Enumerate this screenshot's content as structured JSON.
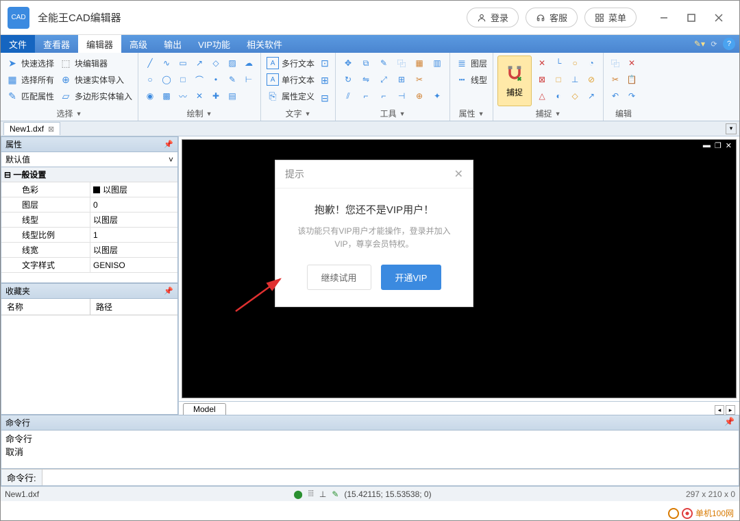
{
  "app": {
    "icon_text": "CAD",
    "title": "全能王CAD编辑器"
  },
  "header_buttons": {
    "login": "登录",
    "support": "客服",
    "menu": "菜单"
  },
  "menubar": {
    "items": [
      "文件",
      "查看器",
      "编辑器",
      "高级",
      "输出",
      "VIP功能",
      "相关软件"
    ],
    "active_file_index": 0,
    "active_tab_index": 2
  },
  "ribbon": {
    "select": {
      "label": "选择",
      "items": [
        "快速选择",
        "选择所有",
        "匹配属性"
      ],
      "col2": [
        "块编辑器",
        "快速实体导入",
        "多边形实体输入"
      ]
    },
    "draw": {
      "label": "绘制"
    },
    "text": {
      "label": "文字",
      "items": [
        "多行文本",
        "单行文本",
        "属性定义"
      ]
    },
    "tools": {
      "label": "工具"
    },
    "attrs": {
      "label": "属性",
      "items": [
        "图层",
        "线型"
      ]
    },
    "capture": {
      "label": "捕捉",
      "btn": "捕捉"
    },
    "edit": {
      "label": "编辑"
    }
  },
  "doc_tab": {
    "name": "New1.dxf"
  },
  "properties": {
    "title": "属性",
    "default": "默认值",
    "section": "一般设置",
    "rows": [
      {
        "k": "色彩",
        "v": "以图层",
        "swatch": true
      },
      {
        "k": "图层",
        "v": "0"
      },
      {
        "k": "线型",
        "v": "以图层"
      },
      {
        "k": "线型比例",
        "v": "1"
      },
      {
        "k": "线宽",
        "v": "以图层"
      },
      {
        "k": "文字样式",
        "v": "GENISO"
      }
    ]
  },
  "favorites": {
    "title": "收藏夹",
    "col1": "名称",
    "col2": "路径"
  },
  "model_tab": "Model",
  "command": {
    "title": "命令行",
    "log": [
      "命令行",
      "取消"
    ],
    "prompt": "命令行:"
  },
  "statusbar": {
    "file": "New1.dxf",
    "coords": "(15.42115; 15.53538; 0)",
    "dimensions": "297 x 210 x 0"
  },
  "dialog": {
    "title": "提示",
    "heading": "抱歉！您还不是VIP用户！",
    "message": "该功能只有VIP用户才能操作，登录并加入VIP，尊享会员特权。",
    "btn_continue": "继续试用",
    "btn_vip": "开通VIP"
  },
  "watermark": "单机100网"
}
